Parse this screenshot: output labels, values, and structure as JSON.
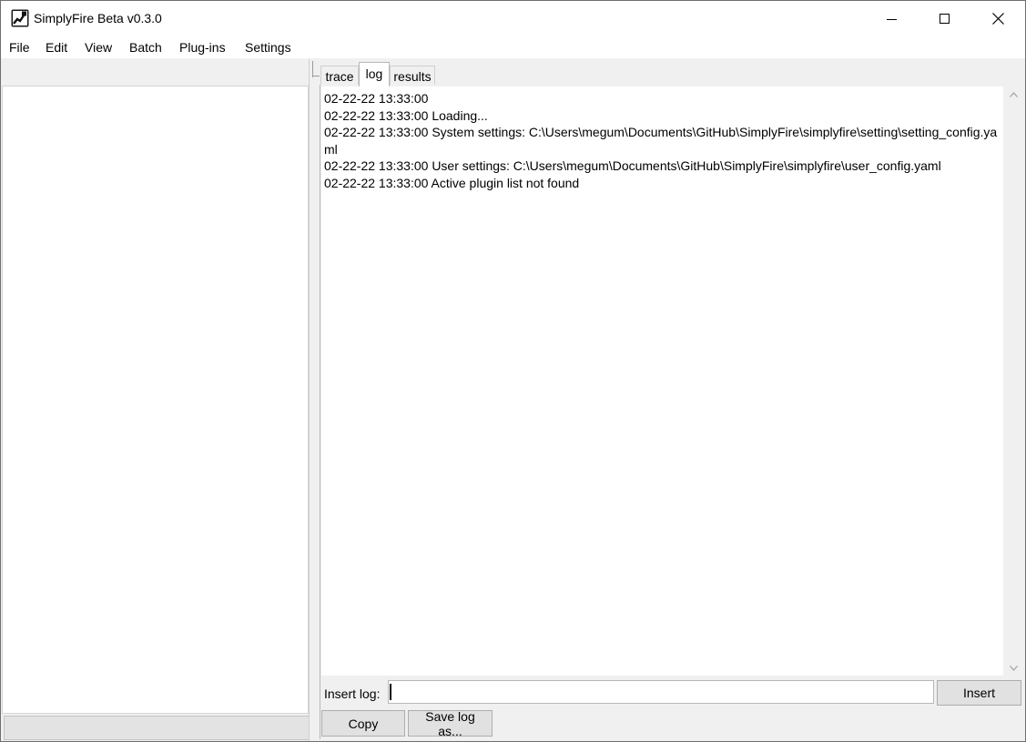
{
  "window": {
    "title": "SimplyFire Beta v0.3.0",
    "app_icon": "simplyfire-app-icon"
  },
  "menu": [
    {
      "label": "File"
    },
    {
      "label": "Edit"
    },
    {
      "label": "View"
    },
    {
      "label": "Batch"
    },
    {
      "label": "Plug-ins"
    },
    {
      "label": "Settings"
    }
  ],
  "tabs": [
    {
      "label": "trace",
      "selected": false
    },
    {
      "label": "log",
      "selected": true
    },
    {
      "label": "results",
      "selected": false
    }
  ],
  "log": {
    "lines": [
      "02-22-22 13:33:00",
      "02-22-22 13:33:00 Loading...",
      "02-22-22 13:33:00 System settings: C:\\Users\\megum\\Documents\\GitHub\\SimplyFire\\simplyfire\\setting\\setting_config.yaml",
      "02-22-22 13:33:00 User settings: C:\\Users\\megum\\Documents\\GitHub\\SimplyFire\\simplyfire\\user_config.yaml",
      "02-22-22 13:33:00 Active plugin list not found"
    ],
    "insert_label": "Insert log:",
    "insert_value": "",
    "insert_button": "Insert",
    "copy_button": "Copy",
    "save_button": "Save log as..."
  },
  "icons": {
    "minimize": "minimize-icon",
    "maximize": "maximize-icon",
    "close": "close-icon",
    "scroll_up": "chevron-up-icon",
    "scroll_down": "chevron-down-icon"
  }
}
